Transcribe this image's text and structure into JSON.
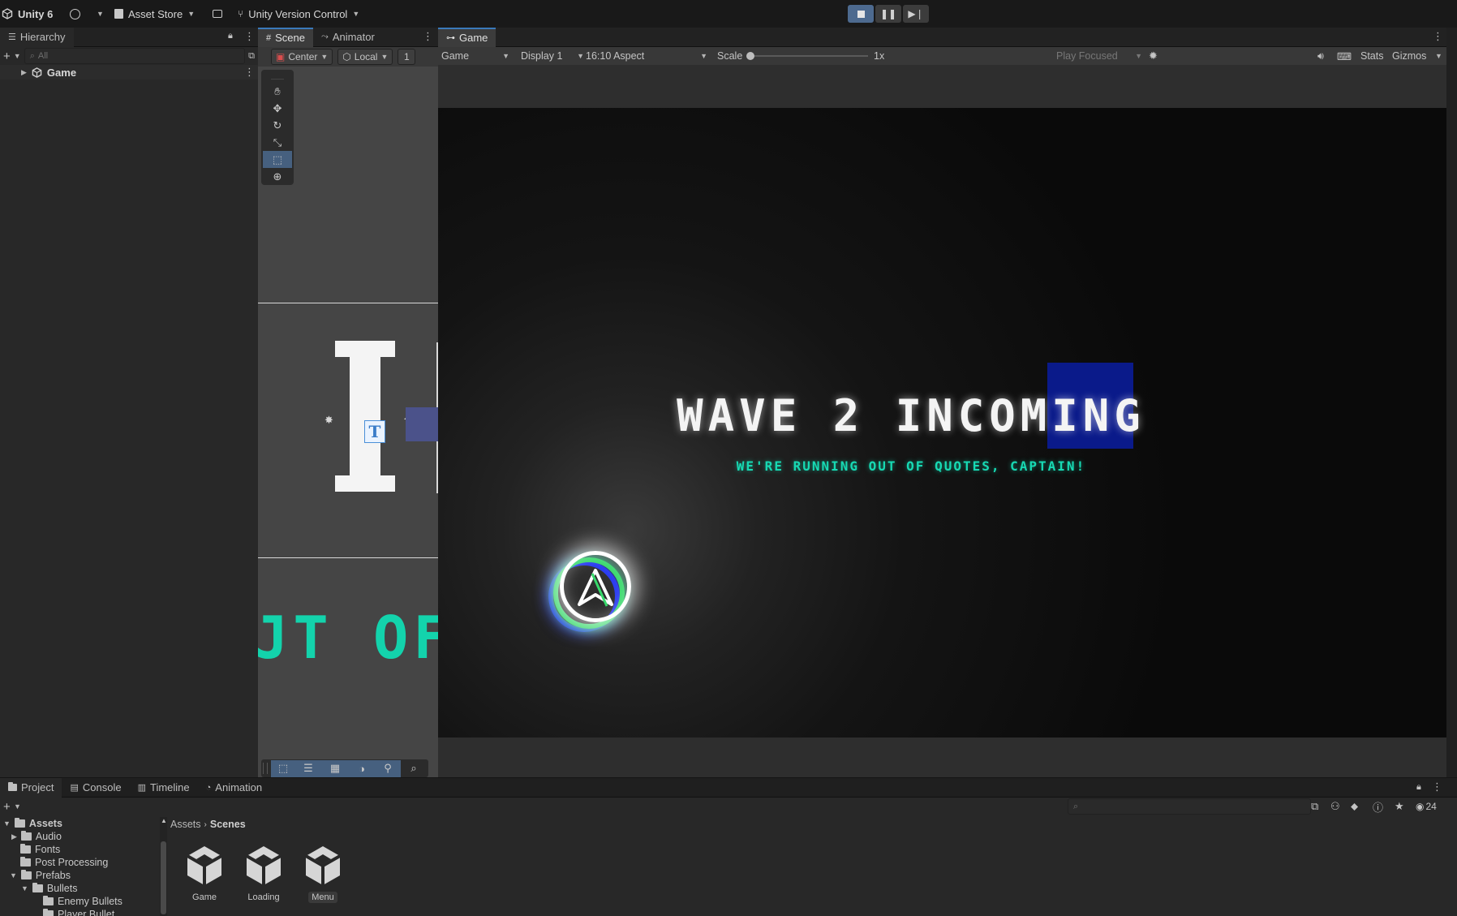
{
  "topbar": {
    "app_label": "Unity 6",
    "asset_store": "Asset Store",
    "version_control": "Unity Version Control"
  },
  "hierarchy": {
    "tab": "Hierarchy",
    "search_placeholder": "All",
    "root_item": "Game"
  },
  "scene": {
    "tabs": [
      "Scene",
      "Animator"
    ],
    "pivot": "Center",
    "space": "Local",
    "snap_value": "1",
    "preview_text": "JT OF"
  },
  "game": {
    "tab": "Game",
    "view_mode": "Game",
    "display": "Display 1",
    "aspect": "16:10 Aspect",
    "scale_label": "Scale",
    "scale_value": "1x",
    "play_mode": "Play Focused",
    "stats": "Stats",
    "gizmos": "Gizmos",
    "headline": "WAVE 2 INCOMING",
    "subline": "WE'RE RUNNING OUT OF QUOTES, CAPTAIN!"
  },
  "bottom": {
    "tabs": [
      "Project",
      "Console",
      "Timeline",
      "Animation"
    ],
    "visible_count": "24",
    "breadcrumb": [
      "Assets",
      "Scenes"
    ],
    "tree": [
      {
        "label": "Assets",
        "depth": 0
      },
      {
        "label": "Audio",
        "depth": 1
      },
      {
        "label": "Fonts",
        "depth": 1
      },
      {
        "label": "Post Processing",
        "depth": 1
      },
      {
        "label": "Prefabs",
        "depth": 0
      },
      {
        "label": "Bullets",
        "depth": 1
      },
      {
        "label": "Enemy Bullets",
        "depth": 2
      },
      {
        "label": "Player Bullet",
        "depth": 2
      }
    ],
    "assets": [
      "Game",
      "Loading",
      "Menu"
    ]
  },
  "colors": {
    "accent": "#3a79bb",
    "game_subline": "#17d9b3",
    "scene_text": "#13d3ac",
    "highlight_block": "#0a1a8a"
  }
}
